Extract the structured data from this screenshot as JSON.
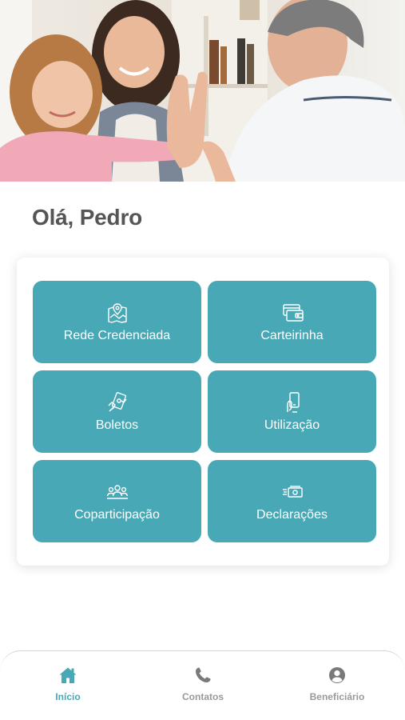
{
  "greeting": "Olá, Pedro",
  "colors": {
    "accent": "#48a8b5",
    "text_dark": "#555555",
    "nav_inactive": "#9a9a9a"
  },
  "menu": {
    "items": [
      {
        "label": "Rede Credenciada",
        "icon": "map-pin-icon"
      },
      {
        "label": "Carteirinha",
        "icon": "card-wallet-icon"
      },
      {
        "label": "Boletos",
        "icon": "cash-hands-icon"
      },
      {
        "label": "Utilização",
        "icon": "hand-phone-icon"
      },
      {
        "label": "Coparticipação",
        "icon": "people-group-icon"
      },
      {
        "label": "Declarações",
        "icon": "money-bill-icon"
      }
    ]
  },
  "nav": {
    "items": [
      {
        "label": "Início",
        "icon": "home-icon",
        "active": true
      },
      {
        "label": "Contatos",
        "icon": "phone-icon",
        "active": false
      },
      {
        "label": "Beneficiário",
        "icon": "user-circle-icon",
        "active": false
      }
    ]
  }
}
